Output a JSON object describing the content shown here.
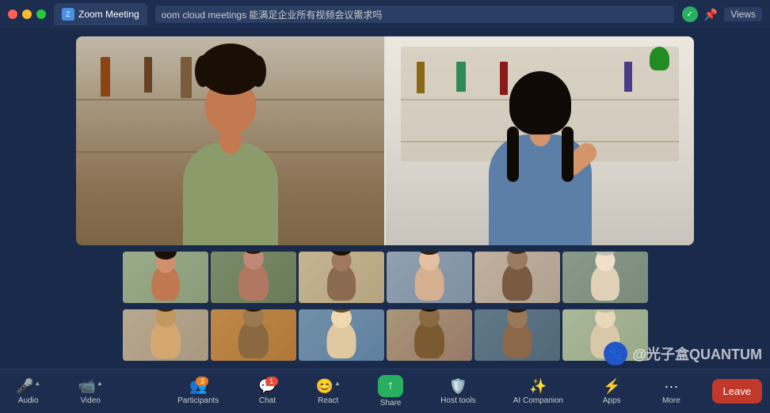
{
  "titlebar": {
    "tab_label": "Zoom Meeting",
    "address_text": "oom cloud meetings 能满足企业所有视频会议需求吗",
    "views_label": "Views",
    "shield_icon": "✓",
    "pin_icon": "📌"
  },
  "toolbar": {
    "audio_label": "Audio",
    "video_label": "Video",
    "participants_label": "Participants",
    "participants_count": "3",
    "chat_label": "Chat",
    "chat_badge": "1",
    "react_label": "React",
    "share_label": "Share",
    "host_tools_label": "Host tools",
    "ai_companion_label": "AI Companion",
    "apps_label": "Apps",
    "more_label": "More",
    "leave_label": "Leave"
  },
  "watermark": {
    "text": "@光子盒QUANTUM"
  },
  "thumbnails": {
    "row1": [
      {
        "id": "t1",
        "color": "t1"
      },
      {
        "id": "t2",
        "color": "t2"
      },
      {
        "id": "t3",
        "color": "t3"
      },
      {
        "id": "t4",
        "color": "t4"
      },
      {
        "id": "t5",
        "color": "t5"
      },
      {
        "id": "t6",
        "color": "t6"
      }
    ],
    "row2": [
      {
        "id": "t7",
        "color": "t7"
      },
      {
        "id": "t8",
        "color": "t8"
      },
      {
        "id": "t9",
        "color": "t9"
      },
      {
        "id": "t10",
        "color": "t10"
      },
      {
        "id": "t11",
        "color": "t11"
      },
      {
        "id": "t12",
        "color": "t12"
      }
    ]
  }
}
